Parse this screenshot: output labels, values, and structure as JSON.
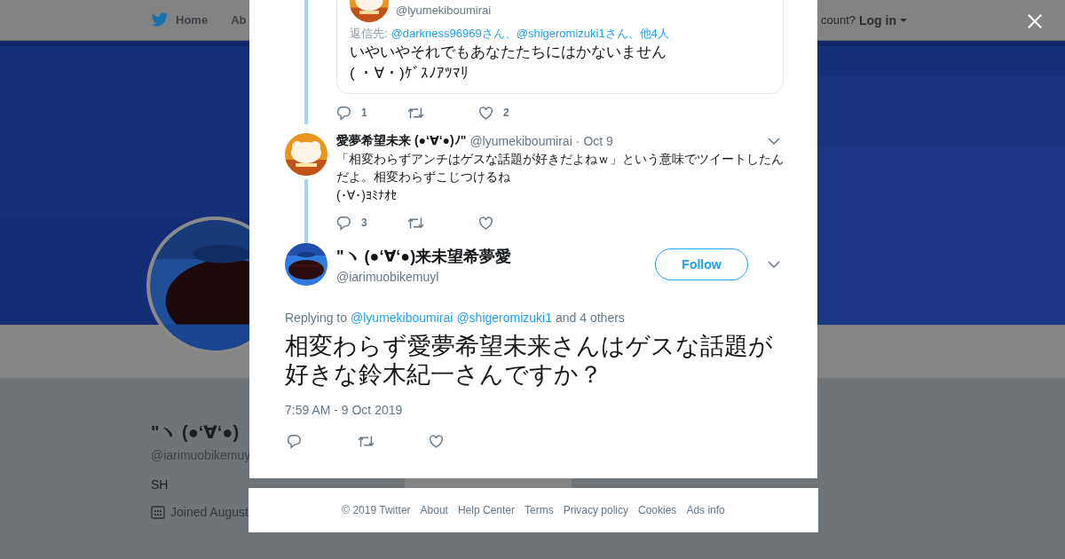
{
  "header": {
    "nav": [
      {
        "label": "Home"
      },
      {
        "label": "Ab"
      }
    ],
    "account_prompt": "count?",
    "login": "Log in"
  },
  "profile": {
    "name": "\"ヽ (●‘∀‘●)",
    "handle": "@iarimuobikemuy",
    "bio": "SH",
    "joined": "Joined August"
  },
  "thread": [
    {
      "kind": "quote",
      "quoted": {
        "handle": "@lyumekiboumirai",
        "reply_label": "返信先:",
        "reply_to": "@darkness96969さん、@shigeromizuki1さん、他4人",
        "lines": [
          "いやいやそれでもあなたたちにはかないません",
          "( ・∀・)ｹﾞｽﾉｱﾂﾏﾘ"
        ]
      },
      "replies": "1",
      "likes": "2"
    },
    {
      "kind": "tweet",
      "name": "愛夢希望未来 (●‘∀‘●)ﾉ\"",
      "handle": "@lyumekiboumirai",
      "separator": "·",
      "date": "Oct 9",
      "lines": [
        "「相変わらずアンチはゲスな話題が好きだよねｗ」という意味でツイートしたんだよ。相変わらずこじつけるね",
        "(･∀･)ﾖﾐﾅｵｾ"
      ],
      "replies": "3"
    }
  ],
  "main_tweet": {
    "name": "\"ヽ (●‘∀‘●)来未望希夢愛",
    "handle": "@iarimuobikemuyl",
    "follow": "Follow",
    "replying_label": "Replying to",
    "mentions": [
      "@lyumekiboumirai",
      "@shigeromizuki1"
    ],
    "others": "and 4 others",
    "text": "相変わらず愛夢希望未来さんはゲスな話題が好きな鈴木紀一さんですか？",
    "timestamp": "7:59 AM - 9 Oct 2019"
  },
  "footer": {
    "links": [
      "© 2019 Twitter",
      "About",
      "Help Center",
      "Terms",
      "Privacy policy",
      "Cookies",
      "Ads info"
    ]
  }
}
